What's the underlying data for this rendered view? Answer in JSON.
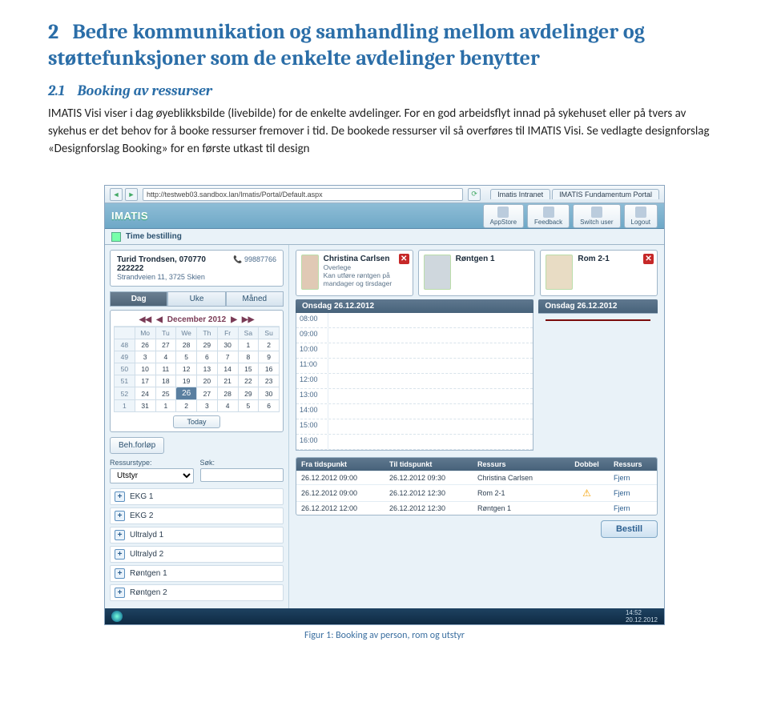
{
  "doc": {
    "h1_num": "2",
    "h1_text": "Bedre kommunikation og samhandling mellom avdelinger og støttefunksjoner som de enkelte avdelinger benytter",
    "h2_num": "2.1",
    "h2_text": "Booking av ressurser",
    "paragraph": "IMATIS Visi viser i dag øyeblikksbilde (livebilde) for de enkelte avdelinger. For en god arbeidsflyt innad på sykehuset eller på tvers av sykehus er det behov for å booke ressurser fremover i tid. De bookede ressurser vil så overføres til IMATIS Visi. Se vedlagte designforslag «Designforslag Booking» for en første utkast til design",
    "figure_caption": "Figur 1: Booking av person, rom og utstyr"
  },
  "browser": {
    "url": "http://testweb03.sandbox.lan/Imatis/Portal/Default.aspx",
    "tab1": "Imatis Intranet",
    "tab2": "IMATIS Fundamentum Portal"
  },
  "brandbar": {
    "logo": "IMATIS",
    "buttons": [
      "AppStore",
      "Feedback",
      "Switch user",
      "Logout"
    ]
  },
  "crumb": {
    "label": "Time bestilling"
  },
  "patient": {
    "name": "Turid Trondsen, 070770 222222",
    "phone_icon": "📞",
    "phone": "99887766",
    "address": "Strandveien 11, 3725 Skien"
  },
  "viewtabs": [
    "Dag",
    "Uke",
    "Måned"
  ],
  "calendar": {
    "month": "December 2012",
    "weekdays": [
      "",
      "Mo",
      "Tu",
      "We",
      "Th",
      "Fr",
      "Sa",
      "Su"
    ],
    "rows": [
      [
        "48",
        "26",
        "27",
        "28",
        "29",
        "30",
        "1",
        "2"
      ],
      [
        "49",
        "3",
        "4",
        "5",
        "6",
        "7",
        "8",
        "9"
      ],
      [
        "50",
        "10",
        "11",
        "12",
        "13",
        "14",
        "15",
        "16"
      ],
      [
        "51",
        "17",
        "18",
        "19",
        "20",
        "21",
        "22",
        "23"
      ],
      [
        "52",
        "24",
        "25",
        "26",
        "27",
        "28",
        "29",
        "30"
      ],
      [
        "1",
        "31",
        "1",
        "2",
        "3",
        "4",
        "5",
        "6"
      ]
    ],
    "selected_row": 4,
    "selected_col": 3,
    "today": "Today"
  },
  "beh_button": "Beh.forløp",
  "filters": {
    "ressurstype_label": "Ressurstype:",
    "ressurstype_value": "Utstyr",
    "sok_label": "Søk:"
  },
  "resources_left": [
    "EKG 1",
    "EKG 2",
    "Ultralyd 1",
    "Ultralyd 2",
    "Røntgen 1",
    "Røntgen 2"
  ],
  "cards": [
    {
      "name": "Christina Carlsen",
      "role": "Overlege",
      "note": "Kan utføre røntgen på mandager og tirsdager",
      "closable": true,
      "thumb": "person"
    },
    {
      "name": "Røntgen 1",
      "role": "",
      "note": "",
      "closable": false,
      "thumb": "eq"
    },
    {
      "name": "Rom 2-1",
      "role": "",
      "note": "",
      "closable": true,
      "thumb": "bed"
    }
  ],
  "dayhead": "Onsdag 26.12.2012",
  "hours": [
    "08:00",
    "09:00",
    "10:00",
    "11:00",
    "12:00",
    "13:00",
    "14:00",
    "15:00",
    "16:00"
  ],
  "ordertable": {
    "headers": [
      "Fra tidspunkt",
      "Til tidspunkt",
      "Ressurs",
      "Dobbel",
      "Ressurs"
    ],
    "rows": [
      {
        "from": "26.12.2012  09:00",
        "to": "26.12.2012  09:30",
        "res": "Christina Carlsen",
        "dbl": "",
        "act": "Fjern"
      },
      {
        "from": "26.12.2012  09:00",
        "to": "26.12.2012  12:30",
        "res": "Rom 2-1",
        "dbl": "⚠",
        "act": "Fjern"
      },
      {
        "from": "26.12.2012  12:00",
        "to": "26.12.2012  12:30",
        "res": "Røntgen 1",
        "dbl": "",
        "act": "Fjern"
      }
    ],
    "bestill": "Bestill"
  },
  "taskbar": {
    "time": "14:52",
    "date": "20.12.2012"
  }
}
